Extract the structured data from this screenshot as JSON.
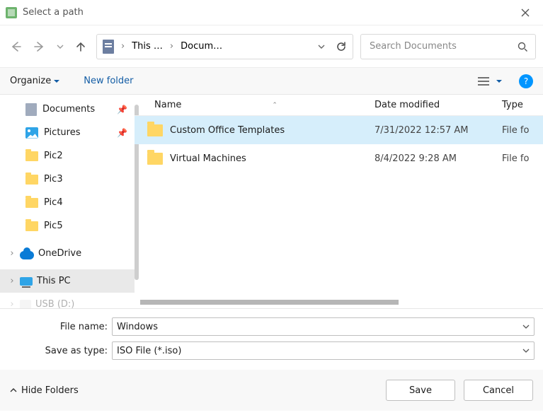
{
  "title": "Select a path",
  "breadcrumb": {
    "seg1": "This …",
    "seg2": "Docum…"
  },
  "search": {
    "placeholder": "Search Documents"
  },
  "toolbar": {
    "organize": "Organize",
    "newfolder": "New folder"
  },
  "columns": {
    "name": "Name",
    "date": "Date modified",
    "type": "Type"
  },
  "tree": {
    "documents": "Documents",
    "pictures": "Pictures",
    "pic2": "Pic2",
    "pic3": "Pic3",
    "pic4": "Pic4",
    "pic5": "Pic5",
    "onedrive": "OneDrive",
    "thispc": "This PC",
    "usb": "USB (D:)"
  },
  "rows": [
    {
      "name": "Custom Office Templates",
      "date": "7/31/2022 12:57 AM",
      "type": "File fo"
    },
    {
      "name": "Virtual Machines",
      "date": "8/4/2022 9:28 AM",
      "type": "File fo"
    }
  ],
  "fields": {
    "filename_label": "File name:",
    "filename_value": "Windows",
    "type_label": "Save as type:",
    "type_value": "ISO File (*.iso)"
  },
  "buttons": {
    "hide": "Hide Folders",
    "save": "Save",
    "cancel": "Cancel"
  }
}
